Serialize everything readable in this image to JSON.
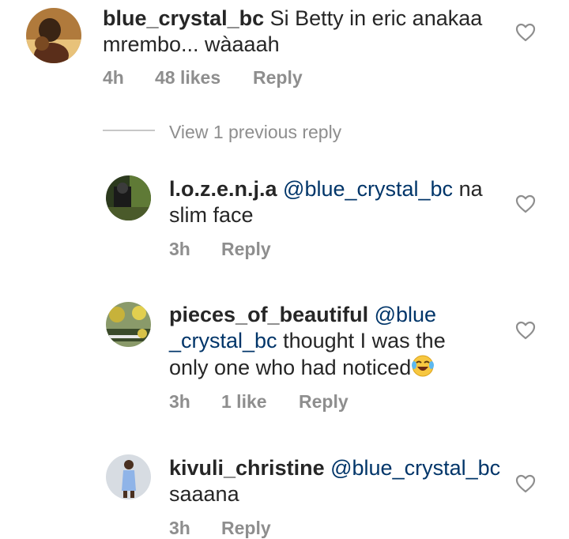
{
  "comments": [
    {
      "username": "blue_crystal_bc",
      "text": "Si Betty in eric anakaa mrembo... wàaaah",
      "time": "4h",
      "likes": "48 likes",
      "reply_label": "Reply"
    },
    {
      "username": "l.o.z.e.n.j.a",
      "mention": "@blue_crystal_bc",
      "text": "na slim face",
      "time": "3h",
      "reply_label": "Reply"
    },
    {
      "username": "pieces_of_beautiful",
      "mention_part1": "@blue",
      "mention_part2": "_crystal_bc",
      "text_line2": "thought I was the",
      "text_line3": "only one who had noticed",
      "emoji": "face-with-tears-of-joy",
      "time": "3h",
      "likes": "1 like",
      "reply_label": "Reply"
    },
    {
      "username": "kivuli_christine",
      "mention": "@blue_crystal_bc",
      "text": "saaana",
      "time": "3h",
      "reply_label": "Reply"
    }
  ],
  "view_previous": "View 1 previous reply",
  "icons": {
    "like": "heart-outline-icon"
  },
  "colors": {
    "text": "#262626",
    "secondary": "#8e8e8e",
    "mention": "#003569"
  }
}
